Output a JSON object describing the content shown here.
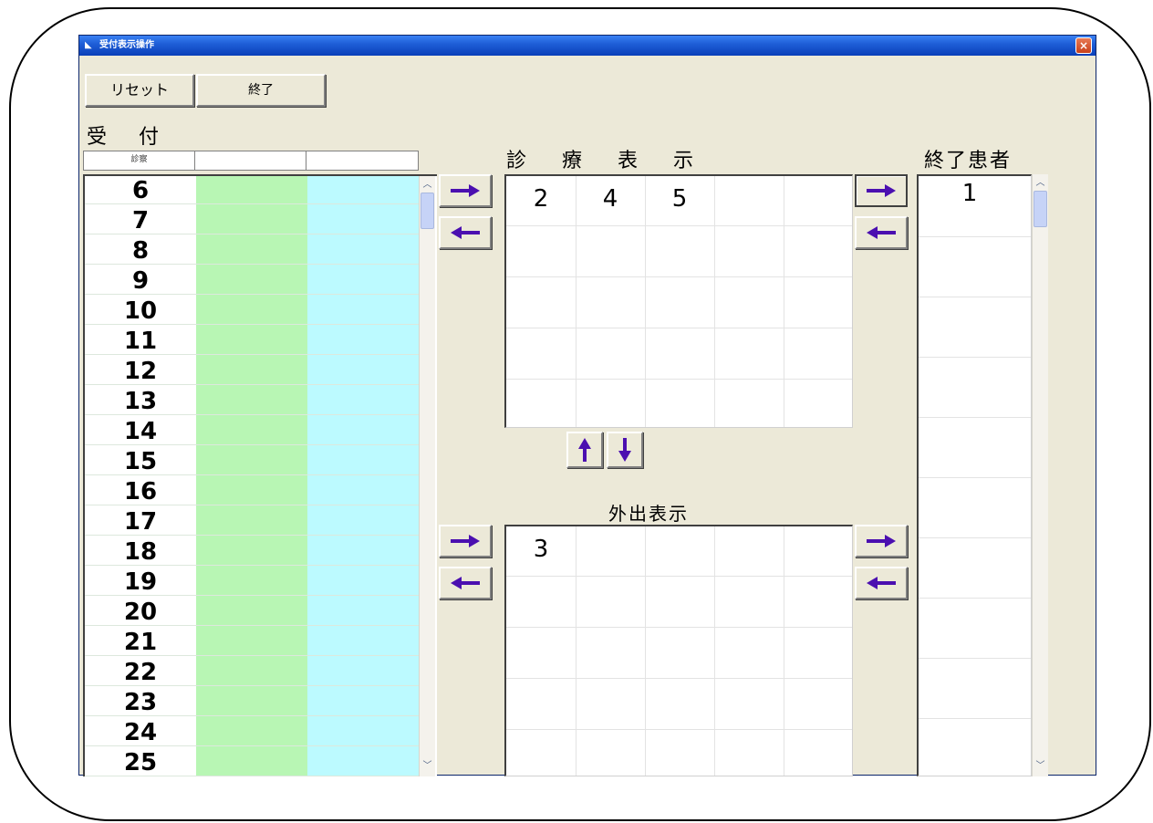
{
  "window": {
    "title": "受付表示操作",
    "close_glyph": "×"
  },
  "toolbar": {
    "reset_label": "リセット",
    "end_label": "終了"
  },
  "labels": {
    "reception": "受 付",
    "treatment_display": "診 療 表 示",
    "finished_patients": "終了患者",
    "out_display": "外出表示"
  },
  "reception": {
    "header": [
      "診察",
      "",
      ""
    ],
    "numbers": [
      "6",
      "7",
      "8",
      "9",
      "10",
      "11",
      "12",
      "13",
      "14",
      "15",
      "16",
      "17",
      "18",
      "19",
      "20",
      "21",
      "22",
      "23",
      "24",
      "25"
    ]
  },
  "treatment_list": {
    "values": [
      "2",
      "4",
      "5"
    ]
  },
  "out_list": {
    "values": [
      "3"
    ]
  },
  "finished_list": {
    "values": [
      "1"
    ]
  },
  "colors": {
    "green_column": "#b8f6b4",
    "cyan_column": "#bcfaff",
    "arrow": "#4b0fb0"
  },
  "icons": {
    "arrow_right": "arrow-right-icon",
    "arrow_left": "arrow-left-icon",
    "arrow_up": "arrow-up-icon",
    "arrow_down": "arrow-down-icon"
  }
}
